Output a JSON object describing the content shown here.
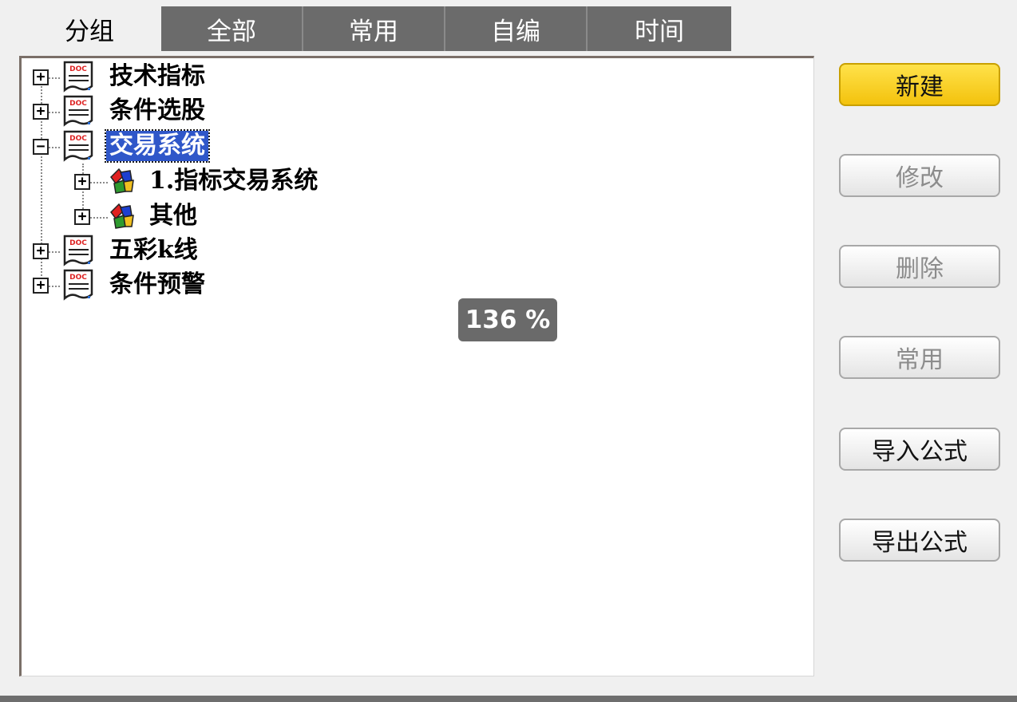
{
  "tabs": [
    {
      "label": "分组",
      "active": true
    },
    {
      "label": "全部",
      "active": false
    },
    {
      "label": "常用",
      "active": false
    },
    {
      "label": "自编",
      "active": false
    },
    {
      "label": "时间",
      "active": false
    }
  ],
  "tree": {
    "nodes": [
      {
        "label": "技术指标",
        "icon": "doc-icon",
        "expander": "+"
      },
      {
        "label": "条件选股",
        "icon": "doc-icon",
        "expander": "+"
      },
      {
        "label": "交易系统",
        "icon": "doc-icon",
        "expander": "−",
        "selected": true
      },
      {
        "label": "1.指标交易系统",
        "icon": "system-icon",
        "expander": "+"
      },
      {
        "label": "其他",
        "icon": "system-icon",
        "expander": "+"
      },
      {
        "label": "五彩k线",
        "icon": "doc-icon",
        "expander": "+"
      },
      {
        "label": "条件预警",
        "icon": "doc-icon",
        "expander": "+"
      }
    ]
  },
  "zoom": {
    "label": "136 %"
  },
  "buttons": {
    "new": "新建",
    "modify": "修改",
    "delete": "删除",
    "common": "常用",
    "import": "导入公式",
    "export": "导出公式"
  },
  "colors": {
    "accent_button": "#f7cb1a",
    "selection": "#2f57c9",
    "tab_inactive": "#6b6b6b"
  }
}
